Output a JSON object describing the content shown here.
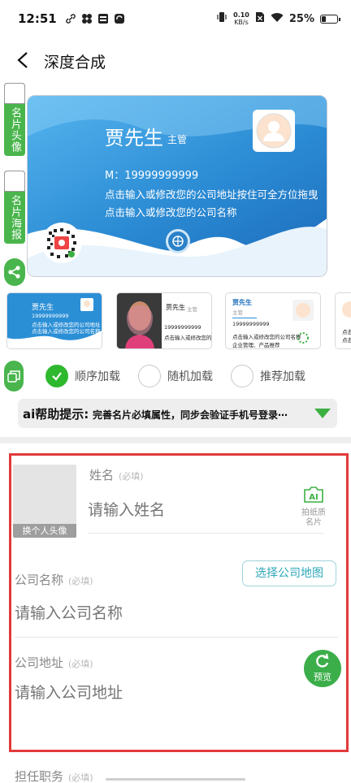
{
  "status_bar": {
    "time": "12:51",
    "net_speed_value": "0.10",
    "net_speed_unit": "KB/s",
    "battery": "25%",
    "battery_level": 0.25
  },
  "header": {
    "title": "深度合成"
  },
  "side_tabs": {
    "card_avatar": "名片头像",
    "card_poster": "名片海报"
  },
  "card": {
    "name": "贾先生",
    "role": "主管",
    "phone": "M：19999999999",
    "address": "点击输入或修改您的公司地址按住可全方位拖曳",
    "company": "点击输入或修改您的公司名称"
  },
  "templates": [
    {
      "name": "贾先生",
      "phone": "19999999999",
      "line1": "点击输入或修改您的公司地址",
      "line2": "点击输入或修改您的公司名称"
    },
    {
      "name": "贾先生",
      "role": "主管",
      "phone": "19999999999",
      "line1": "点击输入或修改您的公司地址"
    },
    {
      "name": "贾先生",
      "role": "主管",
      "phone": "19999999999",
      "line1": "点击输入或修改您的公司名称",
      "line2": "企业管理、产品推荐"
    },
    {
      "name": "贾先生",
      "line1": "点击输入",
      "line2": "点击"
    }
  ],
  "load_options": [
    {
      "label": "顺序加载",
      "selected": true
    },
    {
      "label": "随机加载",
      "selected": false
    },
    {
      "label": "推荐加载",
      "selected": false
    }
  ],
  "ai_hint": {
    "title": "ai帮助提示:",
    "text": "完善名片必填属性，同步会验证手机号登录⋯"
  },
  "form": {
    "avatar_caption": "换个人头像",
    "name_label": "姓名",
    "name_placeholder": "请输入姓名",
    "required_tag": "(必填)",
    "ai_photo_icon_text": "AI",
    "ai_photo_label": "拍纸质名片",
    "company_label": "公司名称",
    "company_placeholder": "请输入公司名称",
    "select_map_button": "选择公司地图",
    "address_label": "公司地址",
    "address_placeholder": "请输入公司地址",
    "preview_button": "预览",
    "position_label": "担任职务"
  },
  "colors": {
    "accent_green": "#49b54c",
    "card_blue": "#2b8fd6",
    "highlight_red": "#e23a3a",
    "map_button_teal": "#2fa7b8"
  }
}
